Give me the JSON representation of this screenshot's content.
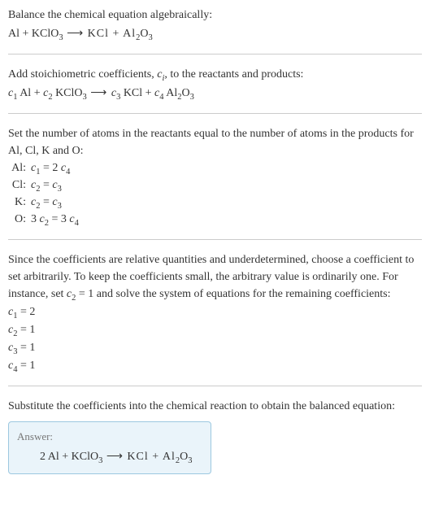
{
  "section1": {
    "prompt": "Balance the chemical equation algebraically:",
    "equation_prefix": "Al + KClO",
    "equation_sub1": "3",
    "equation_mid": "  ⟶  KCl + Al",
    "equation_sub2": "2",
    "equation_mid2": "O",
    "equation_sub3": "3"
  },
  "section2": {
    "prompt_a": "Add stoichiometric coefficients, ",
    "prompt_ci": "c",
    "prompt_i": "i",
    "prompt_b": ", to the reactants and products:",
    "eq_c1": "c",
    "eq_s1": "1",
    "eq_t1": " Al + ",
    "eq_c2": "c",
    "eq_s2": "2",
    "eq_t2": " KClO",
    "eq_s2b": "3",
    "eq_arrow": "  ⟶  ",
    "eq_c3": "c",
    "eq_s3": "3",
    "eq_t3": " KCl + ",
    "eq_c4": "c",
    "eq_s4": "4",
    "eq_t4": " Al",
    "eq_s4b": "2",
    "eq_t5": "O",
    "eq_s4c": "3"
  },
  "section3": {
    "prompt": "Set the number of atoms in the reactants equal to the number of atoms in the products for Al, Cl, K and O:",
    "rows": [
      {
        "el": "Al:",
        "c_l": "c",
        "s_l": "1",
        "mid": " = 2 ",
        "c_r": "c",
        "s_r": "4",
        "tail": ""
      },
      {
        "el": "Cl:",
        "c_l": "c",
        "s_l": "2",
        "mid": " = ",
        "c_r": "c",
        "s_r": "3",
        "tail": ""
      },
      {
        "el": "K:",
        "c_l": "c",
        "s_l": "2",
        "mid": " = ",
        "c_r": "c",
        "s_r": "3",
        "tail": ""
      },
      {
        "el": "O:",
        "pre": "3 ",
        "c_l": "c",
        "s_l": "2",
        "mid": " = 3 ",
        "c_r": "c",
        "s_r": "4",
        "tail": ""
      }
    ]
  },
  "section4": {
    "prompt_a": "Since the coefficients are relative quantities and underdetermined, choose a coefficient to set arbitrarily. To keep the coefficients small, the arbitrary value is ordinarily one. For instance, set ",
    "prompt_c": "c",
    "prompt_s": "2",
    "prompt_b": " = 1 and solve the system of equations for the remaining coefficients:",
    "coefs": [
      {
        "c": "c",
        "s": "1",
        "v": " = 2"
      },
      {
        "c": "c",
        "s": "2",
        "v": " = 1"
      },
      {
        "c": "c",
        "s": "3",
        "v": " = 1"
      },
      {
        "c": "c",
        "s": "4",
        "v": " = 1"
      }
    ]
  },
  "section5": {
    "prompt": "Substitute the coefficients into the chemical reaction to obtain the balanced equation:",
    "answer_label": "Answer:",
    "ans_a": "2 Al + KClO",
    "ans_s1": "3",
    "ans_arrow": "  ⟶  KCl + Al",
    "ans_s2": "2",
    "ans_mid": "O",
    "ans_s3": "3"
  },
  "chart_data": {
    "type": "table",
    "title": "Balancing Al + KClO3 → KCl + Al2O3",
    "atom_balance": [
      {
        "element": "Al",
        "equation": "c1 = 2 c4"
      },
      {
        "element": "Cl",
        "equation": "c2 = c3"
      },
      {
        "element": "K",
        "equation": "c2 = c3"
      },
      {
        "element": "O",
        "equation": "3 c2 = 3 c4"
      }
    ],
    "solution": {
      "c1": 2,
      "c2": 1,
      "c3": 1,
      "c4": 1
    },
    "balanced_equation": "2 Al + KClO3 → KCl + Al2O3"
  }
}
